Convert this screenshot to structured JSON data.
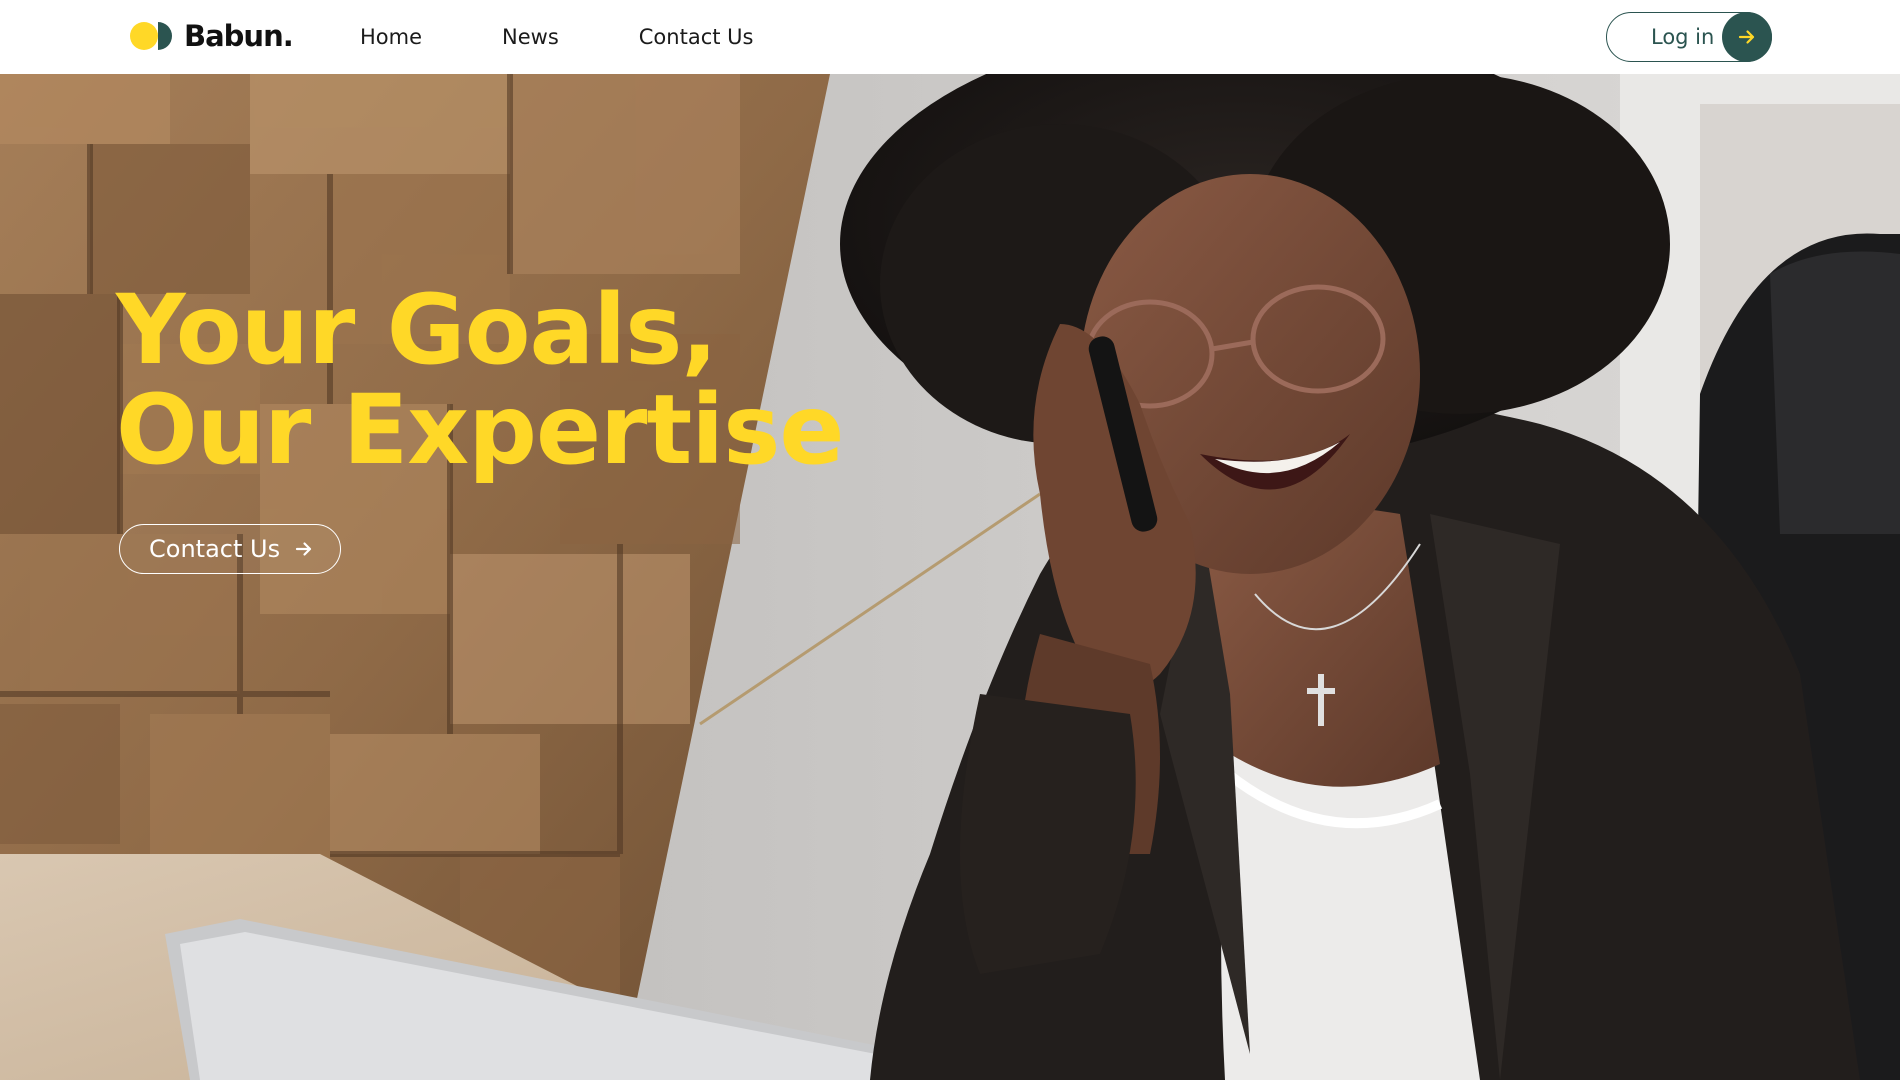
{
  "brand": {
    "name": "Babun.",
    "colors": {
      "yellow": "#ffd827",
      "green": "#2b5450",
      "dark": "#111111"
    }
  },
  "nav": {
    "items": [
      {
        "label": "Home"
      },
      {
        "label": "News"
      },
      {
        "label": "Contact Us"
      }
    ],
    "login": {
      "label": "Log in",
      "icon": "arrow-right-icon"
    }
  },
  "hero": {
    "title_line1": "Your Goals,",
    "title_line2": "Our Expertise",
    "title_color": "#ffd827",
    "cta": {
      "label": "Contact Us",
      "icon": "arrow-right-icon"
    },
    "image": "woman-on-phone-photo"
  }
}
